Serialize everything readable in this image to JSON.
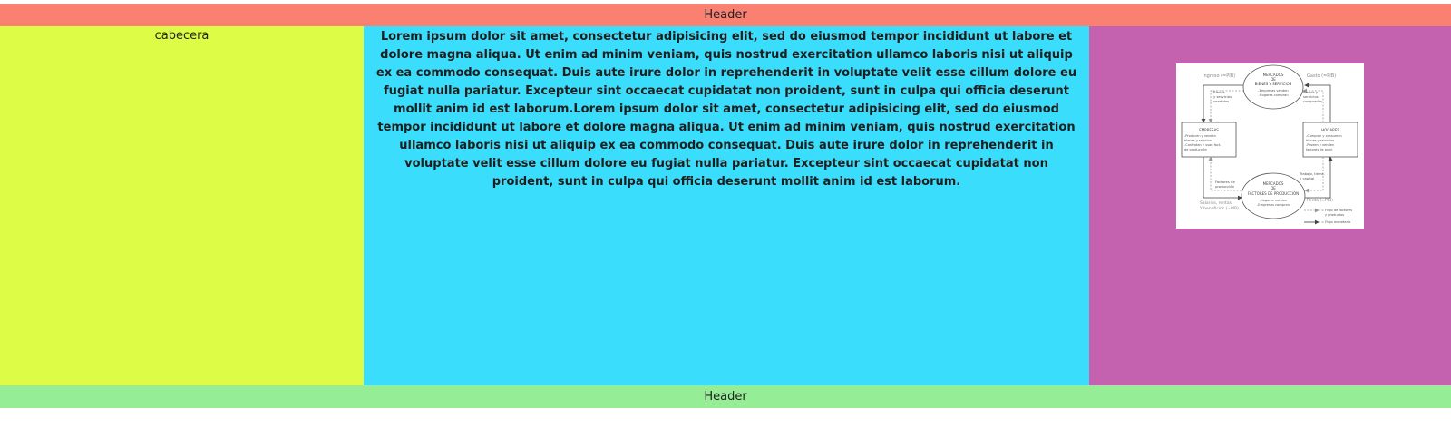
{
  "header": {
    "title": "Header"
  },
  "left_column": {
    "label": "cabecera"
  },
  "main": {
    "paragraph": "Lorem ipsum dolor sit amet, consectetur adipisicing elit, sed do eiusmod tempor incididunt ut labore et dolore magna aliqua. Ut enim ad minim veniam, quis nostrud exercitation ullamco laboris nisi ut aliquip ex ea commodo consequat. Duis aute irure dolor in reprehenderit in voluptate velit esse cillum dolore eu fugiat nulla pariatur. Excepteur sint occaecat cupidatat non proident, sunt in culpa qui officia deserunt mollit anim id est laborum.Lorem ipsum dolor sit amet, consectetur adipisicing elit, sed do eiusmod tempor incididunt ut labore et dolore magna aliqua. Ut enim ad minim veniam, quis nostrud exercitation ullamco laboris nisi ut aliquip ex ea commodo consequat. Duis aute irure dolor in reprehenderit in voluptate velit esse cillum dolore eu fugiat nulla pariatur. Excepteur sint occaecat cupidatat non proident, sunt in culpa qui officia deserunt mollit anim id est laborum."
  },
  "diagram": {
    "top_left_label": "Ingreso (=PIB)",
    "top_right_label": "Gasto (=PIB)",
    "market_goods": {
      "title_line1": "MERCADOS",
      "title_line2": "DE",
      "title_line3": "BIENES Y SERVICIOS",
      "item1": "-Empresas venden",
      "item2": "-Hogares compran"
    },
    "companies": {
      "title": "EMPRESAS",
      "item1": "-Producen y venden",
      "item2": "bienes y servicios",
      "item3": "-Contratan y usan fact.",
      "item4": "de producción"
    },
    "households": {
      "title": "HOGARES",
      "item1": "-Compran y consumen",
      "item2": "bienes y servicios",
      "item3": "-Poseen y venden",
      "item4": "factores de prod."
    },
    "market_factors": {
      "title_line1": "MERCADOS",
      "title_line2": "DE",
      "title_line3": "FACTORES DE PRODUCCIÓN",
      "item1": "-Hogares venden",
      "item2": "-Empresas compran"
    },
    "goods_sold": {
      "line1": "Bienes",
      "line2": "y servicios",
      "line3": "vendidos"
    },
    "goods_bought": {
      "line1": "Bienes y",
      "line2": "servicios",
      "line3": "comprados"
    },
    "factors_prod": {
      "line1": "Factores de",
      "line2": "producción"
    },
    "labor_land": {
      "line1": "Trabajo, tierra,",
      "line2": "y capital"
    },
    "renta_label": "Renta (=PIB)",
    "wages": {
      "line1": "Salarios, rentas",
      "line2": "Y beneficios (=PIB)"
    },
    "legend": {
      "flow_goods_line1": "= Flujo de factores",
      "flow_goods_line2": "y productos",
      "flow_money": "= Flujo monetario"
    }
  },
  "footer": {
    "title": "Header"
  }
}
